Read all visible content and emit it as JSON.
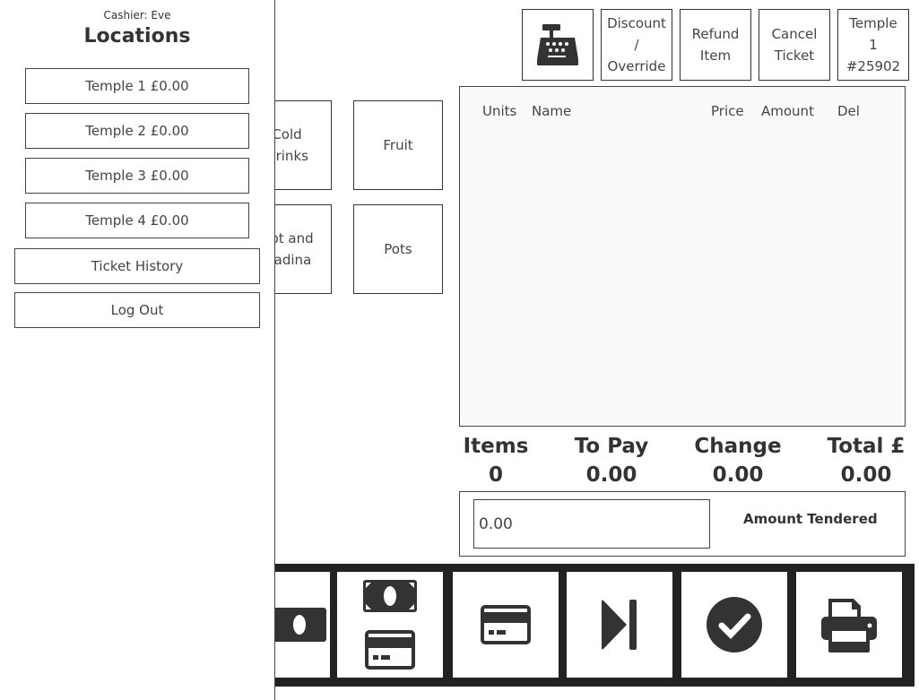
{
  "sidebar": {
    "cashier": "Cashier: Eve",
    "title": "Locations",
    "locations": [
      {
        "label": "Temple 1 £0.00"
      },
      {
        "label": "Temple 2 £0.00"
      },
      {
        "label": "Temple 3 £0.00"
      },
      {
        "label": "Temple 4 £0.00"
      }
    ],
    "ticket_history": "Ticket History",
    "logout": "Log Out"
  },
  "toolbar": {
    "register_icon": "cash-register-icon",
    "discount": "Discount\n/\nOverride",
    "refund": "Refund\nItem",
    "cancel": "Cancel\nTicket",
    "ticket": "Temple\n1\n#25902"
  },
  "categories": [
    {
      "label": "Cold\nDrinks"
    },
    {
      "label": "Fruit"
    },
    {
      "label": "Hot and\nPiadina"
    },
    {
      "label": "Pots"
    }
  ],
  "table": {
    "headers": [
      "Units",
      "Name",
      "Price",
      "Amount",
      "Del"
    ]
  },
  "summary": {
    "items_label": "Items",
    "items": "0",
    "topay_label": "To Pay",
    "topay": "0.00",
    "change_label": "Change",
    "change": "0.00",
    "total_label": "Total £",
    "total": "0.00"
  },
  "tender": {
    "value": "0.00",
    "label": "Amount Tendered"
  },
  "actions": [
    "cash-icon",
    "cash-and-card-icon",
    "card-icon",
    "skip-icon",
    "confirm-icon",
    "print-icon"
  ]
}
